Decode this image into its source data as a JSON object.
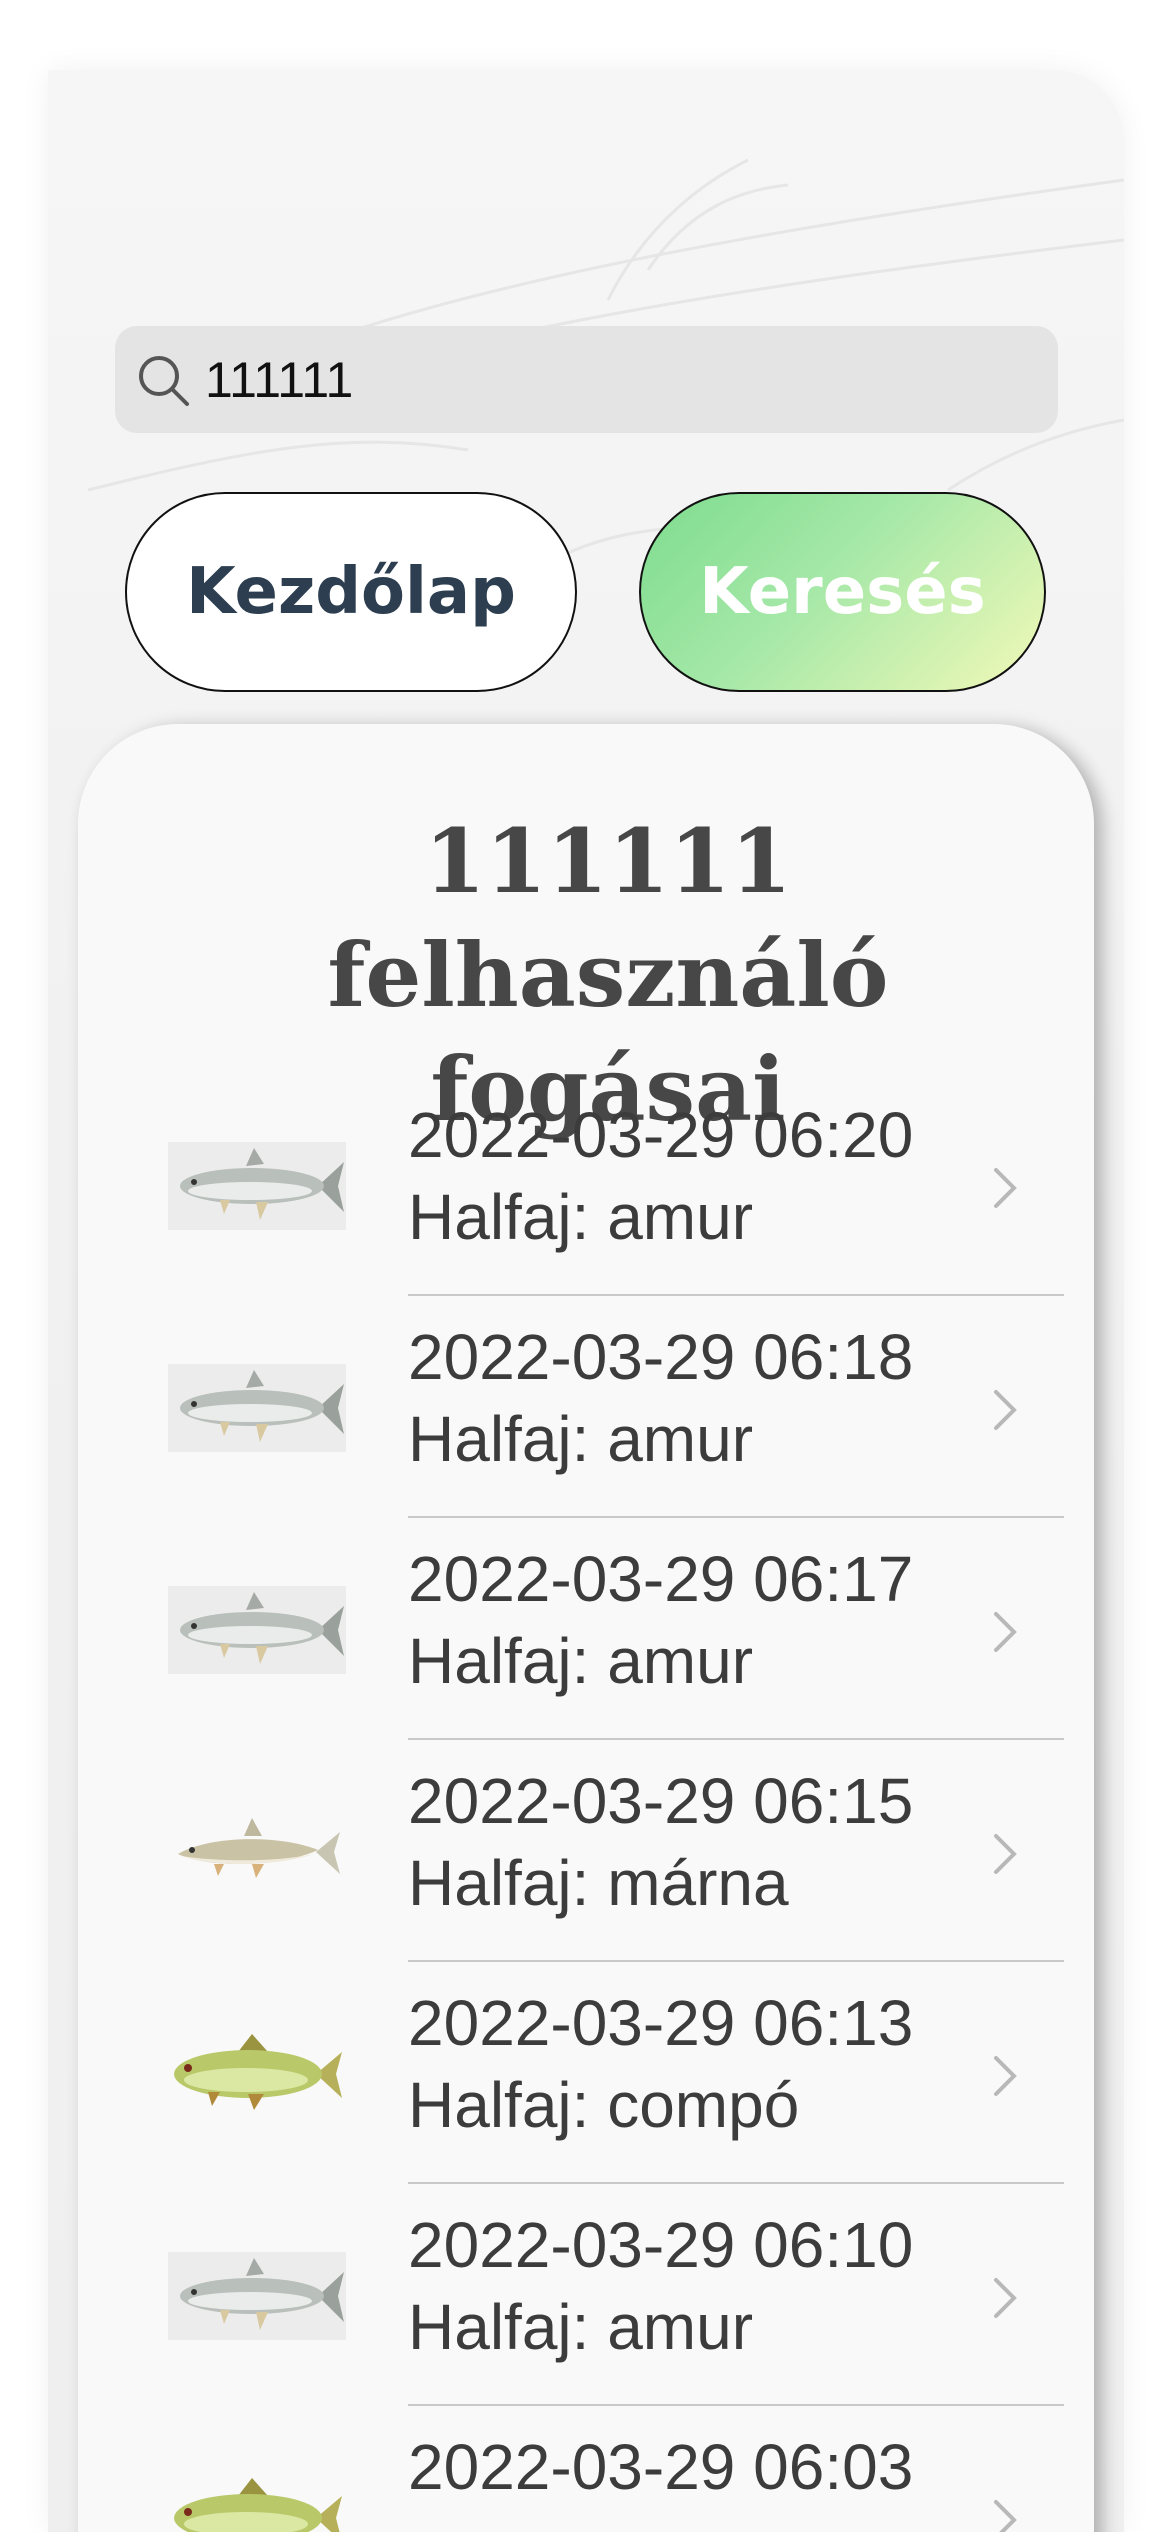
{
  "search": {
    "value": "111111"
  },
  "buttons": {
    "home_label": "Kezdőlap",
    "search_label": "Keresés"
  },
  "card": {
    "title_line1": "111111 felhasználó",
    "title_line2": "fogásai"
  },
  "catches": [
    {
      "datetime": "2022-03-29 06:20",
      "species_label": "Halfaj: amur",
      "icon": "amur-fish-icon"
    },
    {
      "datetime": "2022-03-29 06:18",
      "species_label": "Halfaj: amur",
      "icon": "amur-fish-icon"
    },
    {
      "datetime": "2022-03-29 06:17",
      "species_label": "Halfaj: amur",
      "icon": "amur-fish-icon"
    },
    {
      "datetime": "2022-03-29 06:15",
      "species_label": "Halfaj: márna",
      "icon": "marna-fish-icon"
    },
    {
      "datetime": "2022-03-29 06:13",
      "species_label": "Halfaj: compó",
      "icon": "compo-fish-icon"
    },
    {
      "datetime": "2022-03-29 06:10",
      "species_label": "Halfaj: amur",
      "icon": "amur-fish-icon"
    },
    {
      "datetime": "2022-03-29 06:03",
      "species_label": "",
      "icon": "compo-fish-icon"
    }
  ],
  "colors": {
    "accent_start": "#7ddc8e",
    "accent_end": "#f3f9b8",
    "title": "#474747",
    "home_text": "#2c3e50"
  }
}
